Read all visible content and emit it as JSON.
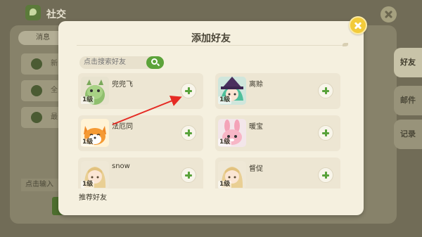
{
  "app": {
    "title": "社交"
  },
  "background": {
    "tab_msg": "消息",
    "rows": [
      {
        "label": "新"
      },
      {
        "label": "全"
      },
      {
        "label": "最"
      }
    ],
    "input_placeholder": "点击输入",
    "right_tabs": [
      "好友",
      "邮件",
      "记录"
    ]
  },
  "modal": {
    "title": "添加好友",
    "search_placeholder": "点击搜索好友",
    "recommend_label": "推荐好友",
    "friends": [
      {
        "name": "兜兜飞",
        "level": "1级",
        "avatar": "green-dino-avatar"
      },
      {
        "name": "离赊",
        "level": "1级",
        "avatar": "witch-girl-avatar"
      },
      {
        "name": "法厄同",
        "level": "1级",
        "avatar": "orange-fox-avatar"
      },
      {
        "name": "暖宝",
        "level": "1级",
        "avatar": "pink-bunny-avatar"
      },
      {
        "name": "snow",
        "level": "1级",
        "avatar": "blonde-girl-avatar"
      },
      {
        "name": "督促",
        "level": "1级",
        "avatar": "blonde-girl-avatar"
      }
    ]
  },
  "colors": {
    "accent_green": "#58a23a",
    "modal_bg": "#f5f0df",
    "card_bg": "#ede6d3",
    "close_yellow": "#f2cb3a",
    "annotation_red": "#e52b24"
  }
}
